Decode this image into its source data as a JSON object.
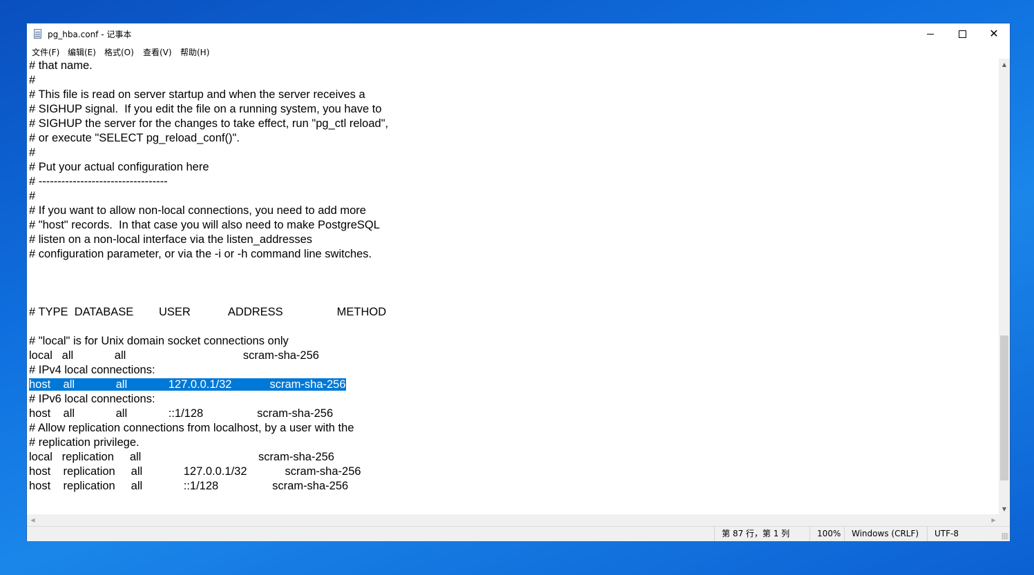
{
  "window": {
    "title": "pg_hba.conf - 记事本",
    "icon": "notepad-icon",
    "controls": {
      "minimize": "minimize-icon",
      "maximize": "maximize-icon",
      "close": "close-icon"
    }
  },
  "menu": [
    {
      "label": "文件(F)"
    },
    {
      "label": "编辑(E)"
    },
    {
      "label": "格式(O)"
    },
    {
      "label": "查看(V)"
    },
    {
      "label": "帮助(H)"
    }
  ],
  "editor": {
    "lines": [
      "# that name.",
      "#",
      "# This file is read on server startup and when the server receives a",
      "# SIGHUP signal.  If you edit the file on a running system, you have to",
      "# SIGHUP the server for the changes to take effect, run \"pg_ctl reload\",",
      "# or execute \"SELECT pg_reload_conf()\".",
      "#",
      "# Put your actual configuration here",
      "# ----------------------------------",
      "#",
      "# If you want to allow non-local connections, you need to add more",
      "# \"host\" records.  In that case you will also need to make PostgreSQL",
      "# listen on a non-local interface via the listen_addresses",
      "# configuration parameter, or via the -i or -h command line switches.",
      "",
      "",
      "",
      "# TYPE  DATABASE        USER            ADDRESS                 METHOD",
      "",
      "# \"local\" is for Unix domain socket connections only",
      "local   all             all                                     scram-sha-256",
      "# IPv4 local connections:",
      "host    all             all             127.0.0.1/32            scram-sha-256",
      "# IPv6 local connections:",
      "host    all             all             ::1/128                 scram-sha-256",
      "# Allow replication connections from localhost, by a user with the",
      "# replication privilege.",
      "local   replication     all                                     scram-sha-256",
      "host    replication     all             127.0.0.1/32            scram-sha-256",
      "host    replication     all             ::1/128                 scram-sha-256"
    ],
    "selected_line": 22,
    "scroll_position": 0.92
  },
  "statusbar": {
    "position": "第 87 行，第 1 列",
    "zoom": "100%",
    "line_ending": "Windows (CRLF)",
    "encoding": "UTF-8"
  },
  "colors": {
    "selection": "#0078d7",
    "desktop": "#0f6fde"
  }
}
